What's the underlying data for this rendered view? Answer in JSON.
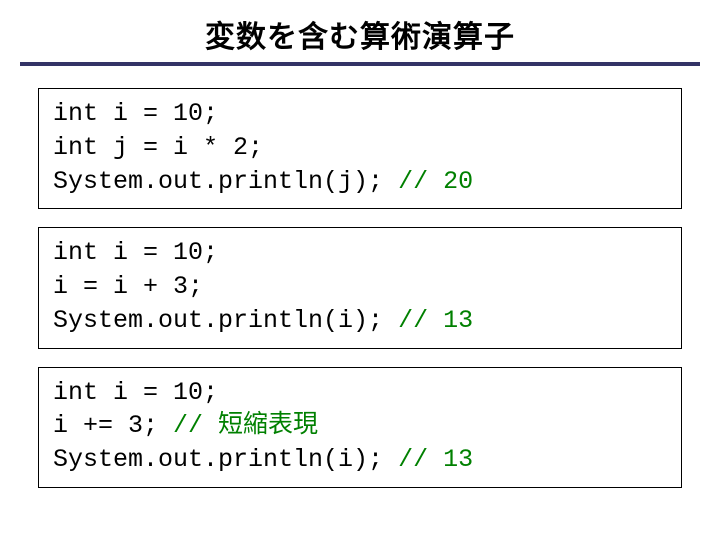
{
  "title": "変数を含む算術演算子",
  "boxes": [
    {
      "lines": [
        {
          "code": "int i = 10;",
          "comment": ""
        },
        {
          "code": "int j = i * 2;",
          "comment": ""
        },
        {
          "code": "System.out.println(j); ",
          "comment": "// 20"
        }
      ]
    },
    {
      "lines": [
        {
          "code": "int i = 10;",
          "comment": ""
        },
        {
          "code": "i = i + 3;",
          "comment": ""
        },
        {
          "code": "System.out.println(i); ",
          "comment": "// 13"
        }
      ]
    },
    {
      "lines": [
        {
          "code": "int i = 10;",
          "comment": ""
        },
        {
          "code": "i += 3; ",
          "comment": "// 短縮表現"
        },
        {
          "code": "System.out.println(i); ",
          "comment": "// 13"
        }
      ]
    }
  ]
}
